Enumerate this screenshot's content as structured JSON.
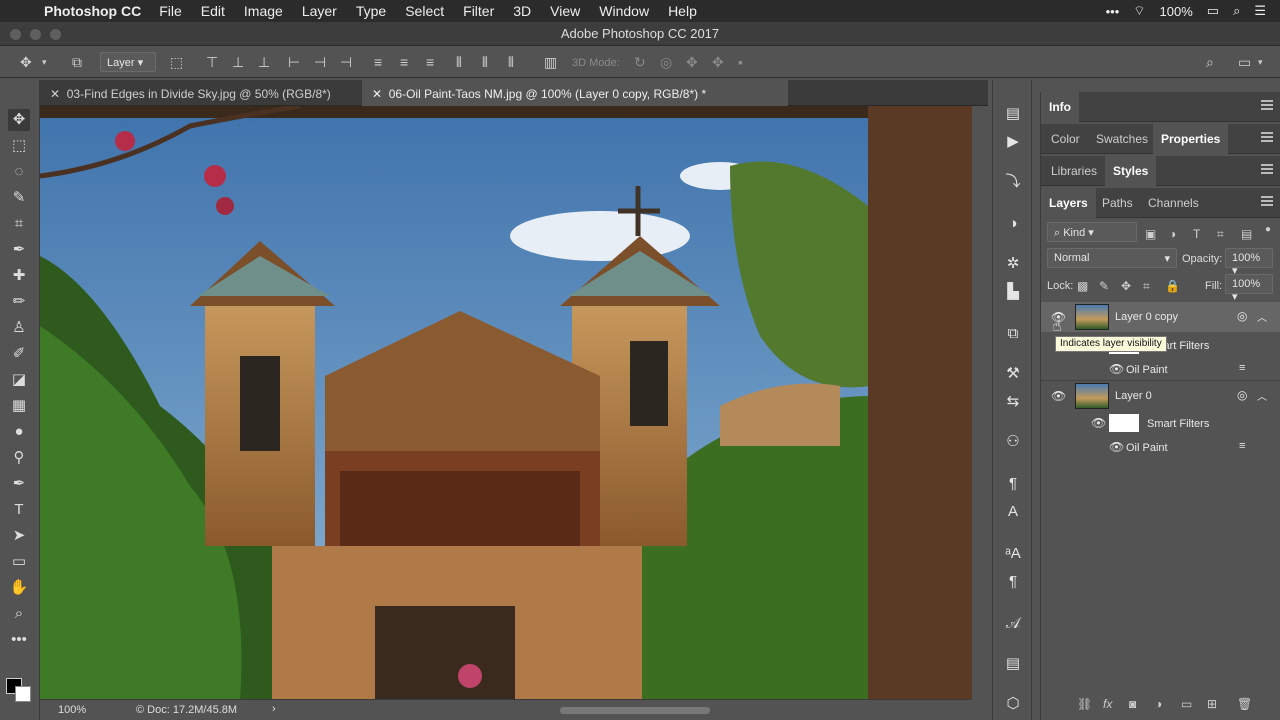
{
  "menubar": {
    "app": "Photoshop CC",
    "items": [
      "File",
      "Edit",
      "Image",
      "Layer",
      "Type",
      "Select",
      "Filter",
      "3D",
      "View",
      "Window",
      "Help"
    ],
    "battery": "100%"
  },
  "window": {
    "title": "Adobe Photoshop CC 2017"
  },
  "options": {
    "layer_select": "Layer",
    "mode_label": "3D Mode:"
  },
  "tabs": [
    {
      "label": "03-Find Edges in Divide Sky.jpg @ 50% (RGB/8*)"
    },
    {
      "label": "06-Oil Paint-Taos NM.jpg @ 100% (Layer 0 copy, RGB/8*) *"
    }
  ],
  "status": {
    "zoom": "100%",
    "doc": "Doc: 17.2M/45.8M"
  },
  "panels": {
    "row1": [
      "Info"
    ],
    "row2": [
      "Color",
      "Swatches",
      "Properties"
    ],
    "row3": [
      "Libraries",
      "Styles"
    ],
    "row4": [
      "Layers",
      "Paths",
      "Channels"
    ]
  },
  "layers_panel": {
    "filter_kind": "Kind",
    "blend_mode": "Normal",
    "opacity_label": "Opacity:",
    "opacity": "100%",
    "lock_label": "Lock:",
    "fill_label": "Fill:",
    "fill": "100%",
    "layers": [
      {
        "name": "Layer 0 copy",
        "smart_filters": "Smart Filters",
        "filter": "Oil Paint"
      },
      {
        "name": "Layer 0",
        "smart_filters": "Smart Filters",
        "filter": "Oil Paint"
      }
    ],
    "tooltip": "Indicates layer visibility"
  },
  "colors": {
    "accent": "#535353",
    "menubar": "#2b2b2b"
  }
}
